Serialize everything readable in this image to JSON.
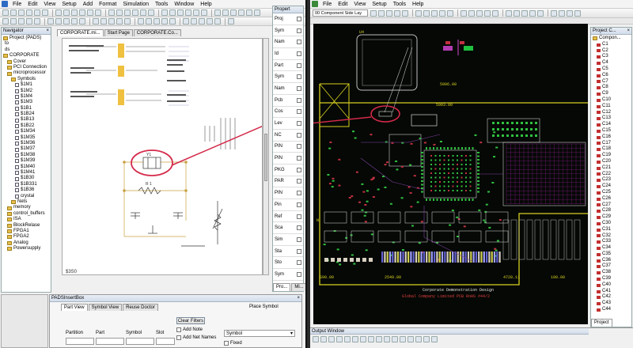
{
  "left_window": {
    "menu": [
      "File",
      "Edit",
      "View",
      "Setup",
      "Add",
      "Format",
      "Simulation",
      "Tools",
      "Window",
      "Help"
    ],
    "navigator": {
      "title": "Navigator",
      "project": "Project (PADS)",
      "items": [
        {
          "label": "CORPORATE",
          "indent": 0,
          "kind": "folder"
        },
        {
          "label": "Cover",
          "indent": 1,
          "kind": "folder"
        },
        {
          "label": "PCI Connection",
          "indent": 1,
          "kind": "folder"
        },
        {
          "label": "microprocessor",
          "indent": 1,
          "kind": "folder"
        },
        {
          "label": "Symbols",
          "indent": 2,
          "kind": "folder"
        },
        {
          "label": "$1M1",
          "indent": 3,
          "kind": "item"
        },
        {
          "label": "$1M2",
          "indent": 3,
          "kind": "item"
        },
        {
          "label": "$1M4",
          "indent": 3,
          "kind": "item"
        },
        {
          "label": "$1M3",
          "indent": 3,
          "kind": "item"
        },
        {
          "label": "$1B1",
          "indent": 3,
          "kind": "item"
        },
        {
          "label": "$1B24",
          "indent": 3,
          "kind": "item"
        },
        {
          "label": "$1B13",
          "indent": 3,
          "kind": "item"
        },
        {
          "label": "$1B22",
          "indent": 3,
          "kind": "item"
        },
        {
          "label": "$1M34",
          "indent": 3,
          "kind": "item"
        },
        {
          "label": "$1M35",
          "indent": 3,
          "kind": "item"
        },
        {
          "label": "$1M36",
          "indent": 3,
          "kind": "item"
        },
        {
          "label": "$1M37",
          "indent": 3,
          "kind": "item"
        },
        {
          "label": "$1M38",
          "indent": 3,
          "kind": "item"
        },
        {
          "label": "$1M39",
          "indent": 3,
          "kind": "item"
        },
        {
          "label": "$1M40",
          "indent": 3,
          "kind": "item"
        },
        {
          "label": "$1M41",
          "indent": 3,
          "kind": "item"
        },
        {
          "label": "$1B30",
          "indent": 3,
          "kind": "item"
        },
        {
          "label": "$1B331",
          "indent": 3,
          "kind": "item"
        },
        {
          "label": "$1B36",
          "indent": 3,
          "kind": "item"
        },
        {
          "label": "crystal",
          "indent": 3,
          "kind": "item"
        },
        {
          "label": "Nets",
          "indent": 2,
          "kind": "folder"
        },
        {
          "label": "memory",
          "indent": 1,
          "kind": "folder"
        },
        {
          "label": "control_buffers",
          "indent": 1,
          "kind": "folder"
        },
        {
          "label": "ISA",
          "indent": 1,
          "kind": "folder"
        },
        {
          "label": "BlockRelase",
          "indent": 1,
          "kind": "folder"
        },
        {
          "label": "FPGA1",
          "indent": 1,
          "kind": "folder"
        },
        {
          "label": "FPGA2",
          "indent": 1,
          "kind": "folder"
        },
        {
          "label": "Analog",
          "indent": 1,
          "kind": "folder"
        },
        {
          "label": "Powersupply",
          "indent": 1,
          "kind": "folder"
        }
      ]
    },
    "doc_tabs": [
      {
        "label": "CORPORATE.mi...",
        "active": true
      },
      {
        "label": "Start Page",
        "active": false
      },
      {
        "label": "CORPORATE.Co...",
        "active": false
      }
    ],
    "schematic": {
      "crystal_ref": "Y1",
      "resistor_label": "R 1",
      "sheet_label": "$3S0"
    },
    "properties": {
      "title": "Propert",
      "rows": [
        "Proj",
        "Sym",
        "Nam",
        "Id",
        "Part",
        "Sym",
        "Nam",
        "Pcb",
        "Cos",
        "Lev",
        "NC",
        "PIN",
        "PIN",
        "PKG",
        "PAR",
        "PIN",
        "Pin",
        "Ref",
        "Sca",
        "Sim",
        "Sta",
        "Sto",
        "Sym"
      ],
      "tabs": [
        "Pro...",
        "Mi..."
      ]
    },
    "bottom_panel": {
      "title": "PADSInsertBox",
      "tabs": [
        "Part View",
        "Symbol View",
        "Reuse Doctor"
      ],
      "place_symbol": "Place Symbol",
      "clear_filters": "Clear Filters",
      "columns": [
        "Partition",
        "Part",
        "Symbol",
        "Slot"
      ],
      "add_note": "Add Note",
      "add_net_names": "Add Net Names",
      "symbol_select": "Symbol",
      "fixed": "Fixed"
    }
  },
  "right_window": {
    "menu": [
      "File",
      "Edit",
      "View",
      "Setup",
      "Tools",
      "Help"
    ],
    "layer_combo": "00 Component Side Lay",
    "board": {
      "title_line1": "Corporate Demonstration Design",
      "title_line2": "Global Company Limited   PCB RoHS  #44/2 ",
      "labels": [
        "U4",
        "5906.00",
        "5903.00",
        "S90.00",
        "2549.00",
        "4728.11",
        "100.00",
        "N"
      ]
    },
    "project_panel": {
      "title": "Project C...",
      "root": "Compon...",
      "items": [
        "C1",
        "C2",
        "C3",
        "C4",
        "C5",
        "C6",
        "C7",
        "C8",
        "C9",
        "C10",
        "C11",
        "C12",
        "C13",
        "C14",
        "C15",
        "C16",
        "C17",
        "C18",
        "C19",
        "C20",
        "C21",
        "C22",
        "C23",
        "C24",
        "C25",
        "C26",
        "C27",
        "C28",
        "C29",
        "C30",
        "C31",
        "C32",
        "C33",
        "C34",
        "C35",
        "C36",
        "C37",
        "C38",
        "C39",
        "C40",
        "C41",
        "C42",
        "C43",
        "C44"
      ],
      "tab": "Project"
    },
    "output_window": "Output Window"
  },
  "colors": {
    "pcb_background": "#050805",
    "highlight": "#d42a4a",
    "trace_yellow": "#d8d020",
    "pad_green": "#30c040"
  }
}
